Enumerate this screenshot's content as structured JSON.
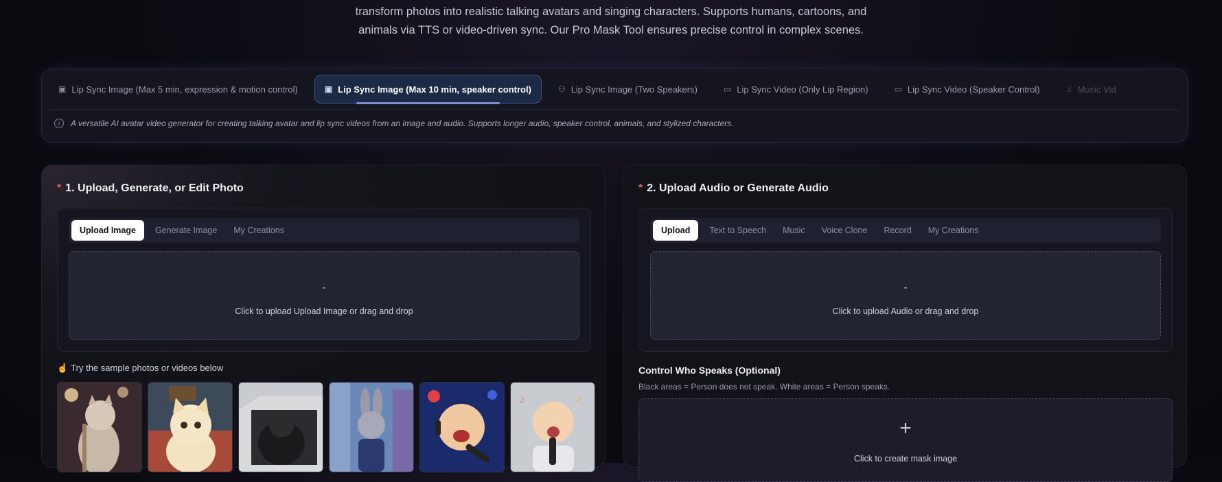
{
  "intro": {
    "line1": "transform photos into realistic talking avatars and singing characters. Supports humans, cartoons, and",
    "line2": "animals via TTS or video-driven sync. Our Pro Mask Tool ensures precise control in complex scenes."
  },
  "mode_tabs": [
    {
      "label": "Lip Sync Image (Max 5 min, expression & motion control)",
      "icon": "image-icon"
    },
    {
      "label": "Lip Sync Image (Max 10 min, speaker control)",
      "icon": "image-icon",
      "active": true
    },
    {
      "label": "Lip Sync Image (Two Speakers)",
      "icon": "users-icon"
    },
    {
      "label": "Lip Sync Video (Only Lip Region)",
      "icon": "video-icon"
    },
    {
      "label": "Lip Sync Video (Speaker Control)",
      "icon": "video-icon"
    },
    {
      "label": "Music Vid",
      "icon": "music-icon"
    }
  ],
  "mode_description": "A versatile AI avatar video generator for creating talking avatar and lip sync videos from an image and audio. Supports longer audio, speaker control, animals, and stylized characters.",
  "photo_card": {
    "required_mark": "*",
    "title": "1. Upload, Generate, or Edit Photo",
    "tabs": [
      "Upload Image",
      "Generate Image",
      "My Creations"
    ],
    "dropzone_mark": "-",
    "dropzone_text": "Click to upload Upload Image or drag and drop",
    "samples_label": "Try the sample photos or videos below"
  },
  "audio_card": {
    "required_mark": "*",
    "title": "2. Upload Audio or Generate Audio",
    "tabs": [
      "Upload",
      "Text to Speech",
      "Music",
      "Voice Clone",
      "Record",
      "My Creations"
    ],
    "dropzone_mark": "-",
    "dropzone_text": "Click to upload Audio or drag and drop",
    "control_title": "Control Who Speaks (Optional)",
    "control_subtitle": "Black areas = Person does not speak. White areas = Person speaks.",
    "mask_plus": "+",
    "mask_text": "Click to create mask image"
  },
  "colors": {
    "accent": "#3a5587",
    "required": "#e05a5a",
    "bulb": "#f4c542"
  }
}
